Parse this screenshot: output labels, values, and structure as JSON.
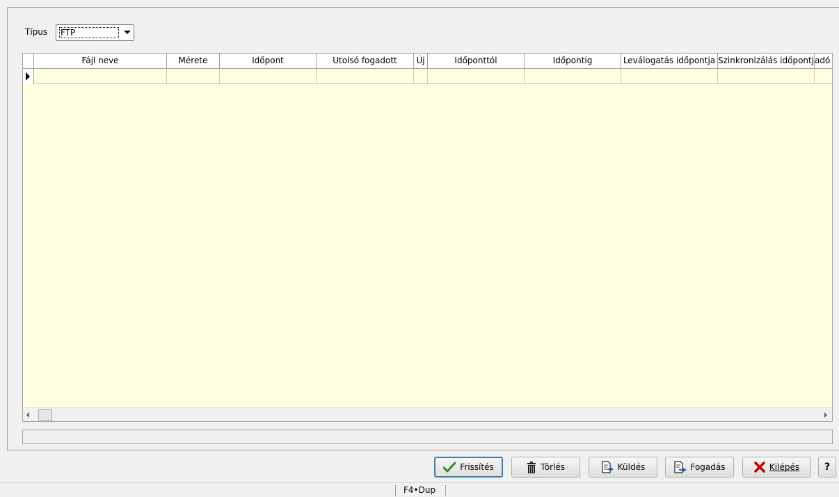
{
  "filter": {
    "type_label": "Típus",
    "type_value": "FTP"
  },
  "grid": {
    "columns": [
      "Fájl neve",
      "Mérete",
      "Időpont",
      "Utolsó fogadott",
      "Új",
      "Időponttól",
      "Időpontig",
      "Leválogatás időpontja",
      "Szinkronizálás időpontja",
      "adó"
    ],
    "rows": [
      [
        "",
        "",
        "",
        "",
        "",
        "",
        "",
        "",
        "",
        ""
      ]
    ],
    "colors": {
      "background": "#ffffe1",
      "header": "#ffffff"
    }
  },
  "buttons": {
    "refresh": "Frissítés",
    "delete": "Törlés",
    "send": "Küldés",
    "receive": "Fogadás",
    "exit": "Kilépés",
    "help": "?"
  },
  "statusbar": {
    "text": "F4•Dup"
  },
  "icons": {
    "refresh": "checkmark-icon",
    "delete": "trash-icon",
    "send": "document-send-icon",
    "receive": "document-receive-icon",
    "exit": "x-icon"
  },
  "accent_colors": {
    "check": "#2a8a2a",
    "exit": "#c00000",
    "doc_arrow": "#1f5fbf"
  }
}
